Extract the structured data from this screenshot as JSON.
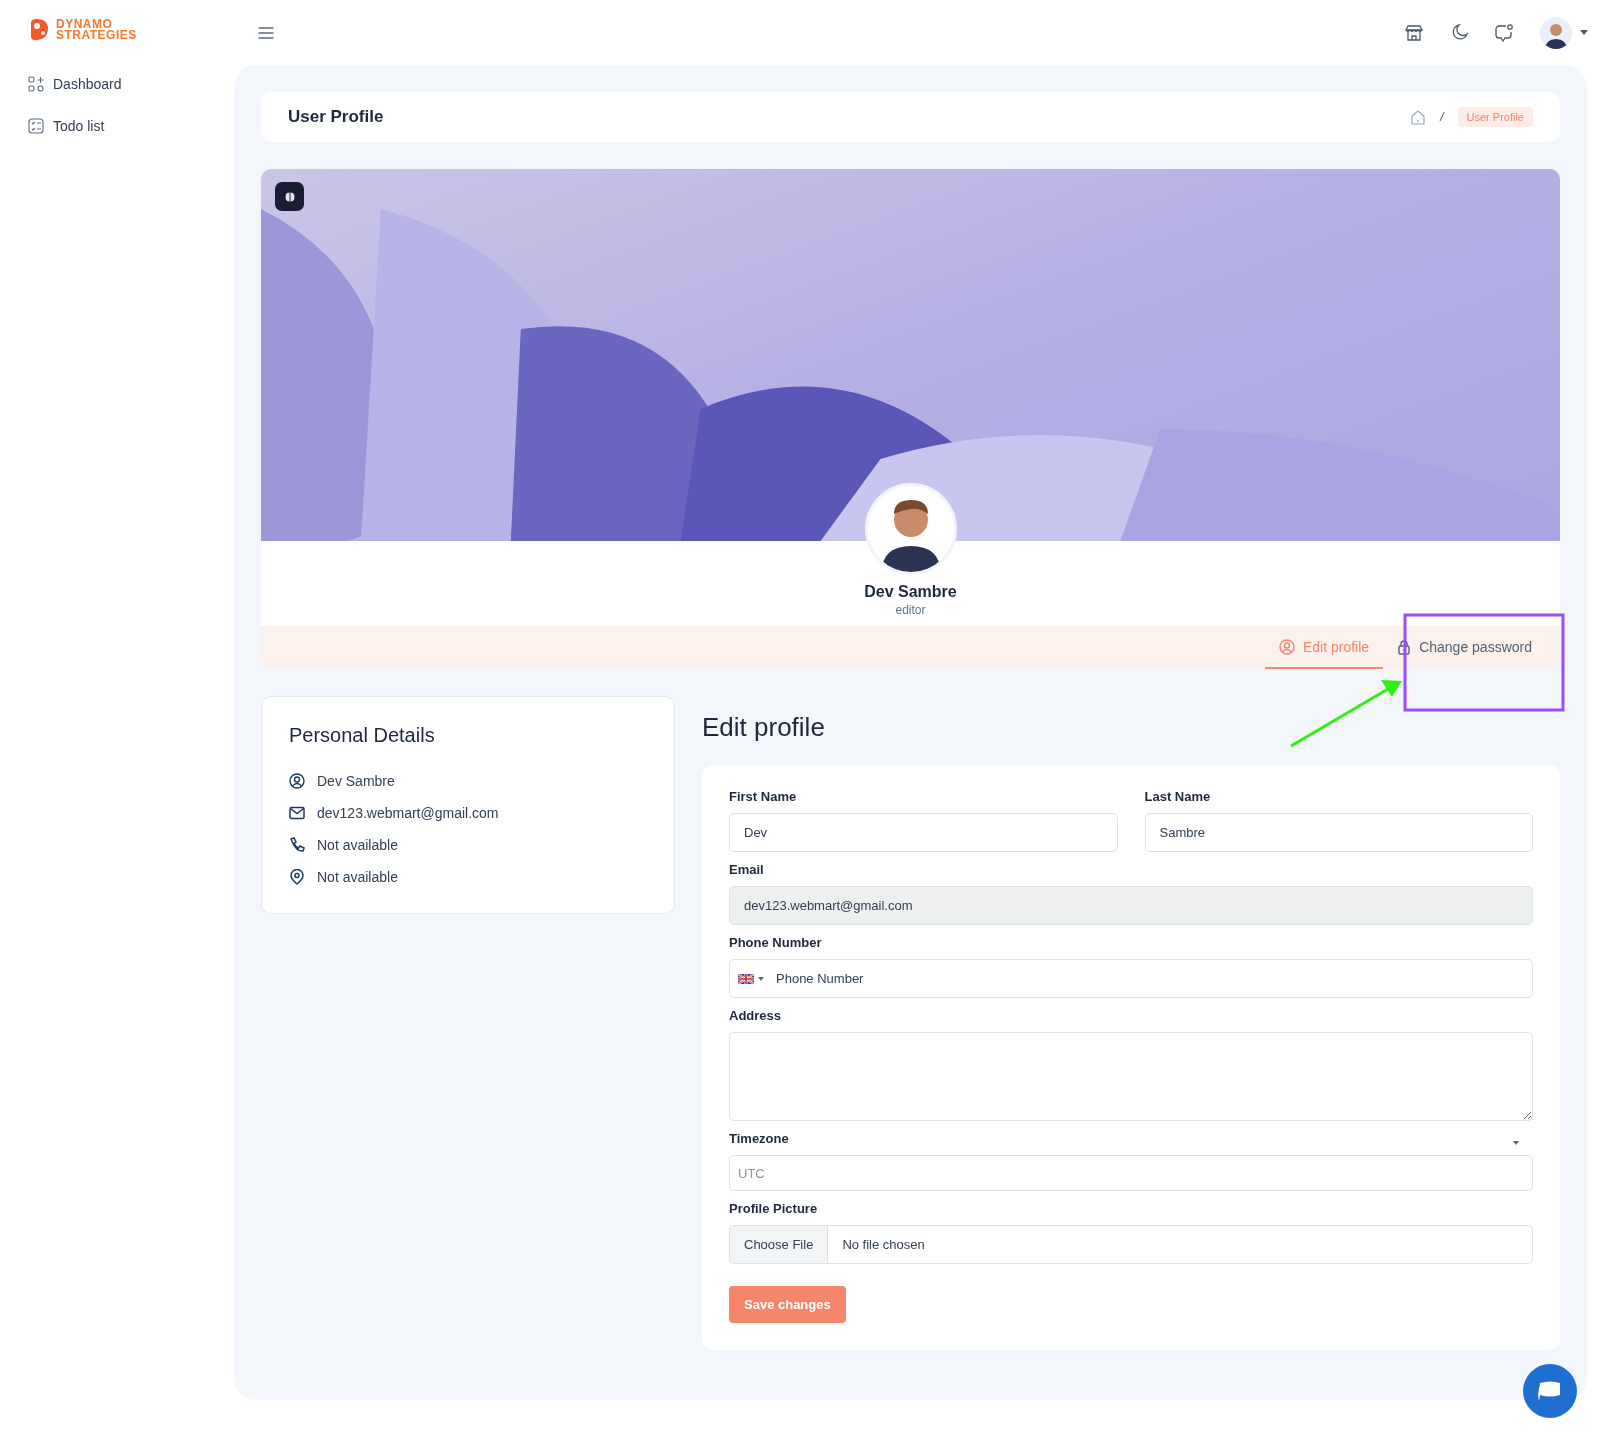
{
  "brand": {
    "line1": "DYNAMO",
    "line2": "STRATEGIES"
  },
  "sidebar": {
    "items": [
      {
        "label": "Dashboard",
        "kind": "dashboard",
        "selected": false
      },
      {
        "label": "Todo list",
        "kind": "todo",
        "selected": false
      }
    ]
  },
  "page_header": {
    "title": "User Profile",
    "breadcrumb_separator": "/",
    "breadcrumb_current": "User Profile"
  },
  "profile": {
    "name": "Dev Sambre",
    "role": "editor"
  },
  "tabs": [
    {
      "label": "Edit profile",
      "kind": "user",
      "selected": true
    },
    {
      "label": "Change password",
      "kind": "lock",
      "selected": false
    }
  ],
  "personal_details": {
    "title": "Personal Details",
    "items": [
      {
        "kind": "user",
        "text": "Dev Sambre"
      },
      {
        "kind": "mail",
        "text": "dev123.webmart@gmail.com"
      },
      {
        "kind": "phone",
        "text": "Not available"
      },
      {
        "kind": "location",
        "text": "Not available"
      }
    ]
  },
  "form": {
    "title": "Edit profile",
    "fields": [
      {
        "kind": "text",
        "label": "First Name",
        "value": "Dev",
        "half": true,
        "disabled": false
      },
      {
        "kind": "text",
        "label": "Last Name",
        "value": "Sambre",
        "half": true,
        "disabled": false
      },
      {
        "kind": "text",
        "label": "Email",
        "value": "dev123.webmart@gmail.com",
        "half": false,
        "disabled": true
      },
      {
        "kind": "phone",
        "label": "Phone Number",
        "placeholder": "Phone Number",
        "half": false,
        "disabled": false
      },
      {
        "kind": "textarea",
        "label": "Address",
        "half": false,
        "disabled": false
      },
      {
        "kind": "select",
        "label": "Timezone",
        "placeholder": "UTC",
        "half": false,
        "disabled": false
      },
      {
        "kind": "file",
        "label": "Profile Picture",
        "button": "Choose File",
        "value": "No file chosen",
        "half": false,
        "disabled": false
      }
    ],
    "submit": "Save changes"
  }
}
